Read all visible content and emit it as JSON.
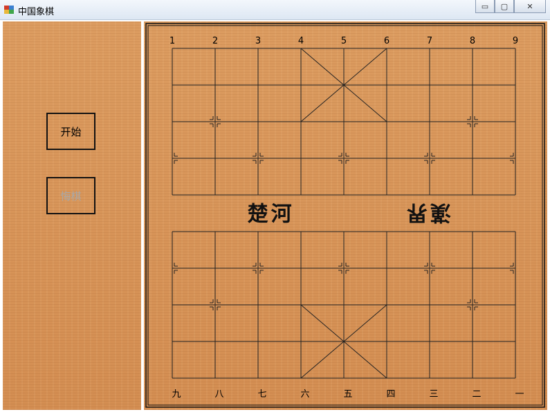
{
  "window": {
    "title": "中国象棋",
    "minimize": "▭",
    "maximize": "▢",
    "close": "✕"
  },
  "controls": {
    "start_label": "开始",
    "regret_label": "悔棋"
  },
  "board": {
    "top_numbers": [
      "1",
      "2",
      "3",
      "4",
      "5",
      "6",
      "7",
      "8",
      "9"
    ],
    "bottom_numbers": [
      "九",
      "八",
      "七",
      "六",
      "五",
      "四",
      "三",
      "二",
      "一"
    ],
    "river_left": "楚河",
    "river_right": "漢界"
  }
}
